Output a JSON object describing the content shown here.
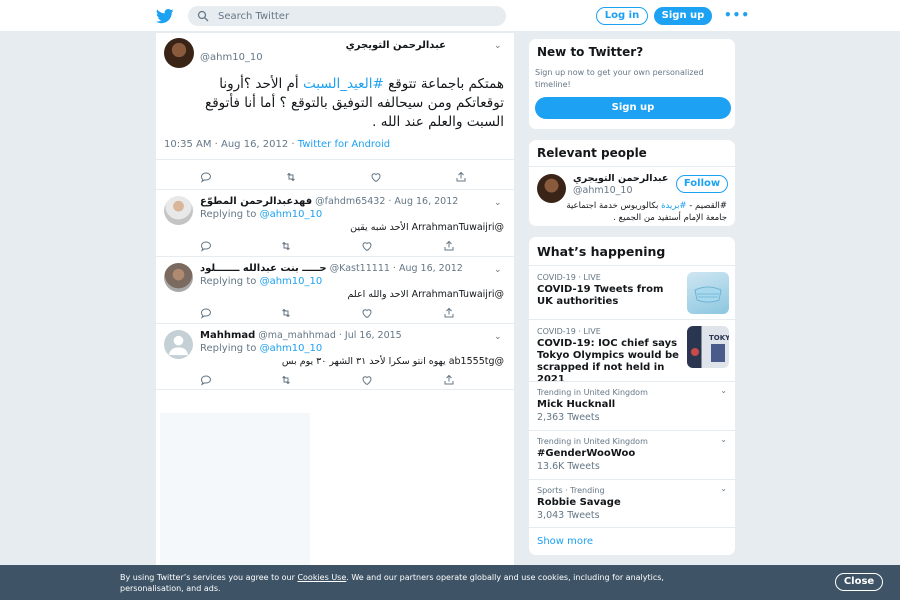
{
  "header": {
    "search_placeholder": "Search Twitter",
    "login_label": "Log in",
    "signup_label": "Sign up",
    "more_label": "•••"
  },
  "tweet": {
    "author_name": "عبدالرحمن التويجري",
    "author_handle": "@ahm10_10",
    "text_before": "همتكم باجماعة تتوقع ",
    "hashtag": "#العيد_السبت",
    "text_after": " أم الأحد ؟أرونا توقعاتكم ومن سيحالفه التوفيق بالتوقع ؟ أما أنا فأتوقع السبت والعلم عند الله .",
    "time": "10:35 AM · Aug 16, 2012 · ",
    "source": "Twitter for Android"
  },
  "replies": [
    {
      "name": "فهدعبدالرحمن المطوّع",
      "handle": "@fahdm65432",
      "date": " · Aug 16, 2012",
      "replying_prefix": "Replying to ",
      "replying_to": "@ahm10_10",
      "text": "@ArrahmanTuwaijri الأحد شبه يقين"
    },
    {
      "name": "حـــــ بنت عبدالله ـــــــلود",
      "handle": "@Kast11111",
      "date": " · Aug 16, 2012",
      "replying_prefix": "Replying to ",
      "replying_to": "@ahm10_10",
      "text": "@ArrahmanTuwaijri الاحد والله اعلم"
    },
    {
      "name": "Mahhmad",
      "handle": "@ma_mahhmad",
      "date": " · Jul 16, 2015",
      "replying_prefix": "Replying to ",
      "replying_to": "@ahm10_10",
      "text": "@ab1555tg يهوه انتو سكرا لأحد ٣١ الشهر ٣٠ يوم بس"
    }
  ],
  "new_to_twitter": {
    "title": "New to Twitter?",
    "description": "Sign up now to get your own personalized timeline!",
    "button": "Sign up"
  },
  "relevant_people": {
    "title": "Relevant people",
    "name": "عبدالرحمن التويجري",
    "handle": "@ahm10_10",
    "follow_label": "Follow",
    "bio_before": "#القصيم - ",
    "bio_hashtag": "#بريدة",
    "bio_after": " بكالوريوس خدمة اجتماعية جامعة الإمام أستفيد من الجميع ."
  },
  "whats_happening": {
    "title": "What’s happening",
    "trends": [
      {
        "meta": "COVID-19 · LIVE",
        "title": "COVID-19 Tweets from UK authorities",
        "count": "",
        "thumb": "mask"
      },
      {
        "meta": "COVID-19 · LIVE",
        "title": "COVID-19: IOC chief says Tokyo Olympics would be scrapped if not held in 2021",
        "count": "",
        "thumb": "tokyo"
      },
      {
        "meta": "Trending in United Kingdom",
        "title": "Mick Hucknall",
        "count": "2,363 Tweets"
      },
      {
        "meta": "Trending in United Kingdom",
        "title": "#GenderWooWoo",
        "count": "13.6K Tweets"
      },
      {
        "meta": "Sports · Trending",
        "title": "Robbie Savage",
        "count": "3,043 Tweets"
      }
    ],
    "show_more": "Show more"
  },
  "cookie": {
    "text_before": "By using Twitter’s services you agree to our ",
    "link": "Cookies Use",
    "text_after": ". We and our partners operate globally and use cookies, including for analytics, personalisation, and ads.",
    "close_label": "Close"
  },
  "colors": {
    "brand": "#1da1f2",
    "background": "#e6ecf0",
    "banner": "#3e5466"
  }
}
